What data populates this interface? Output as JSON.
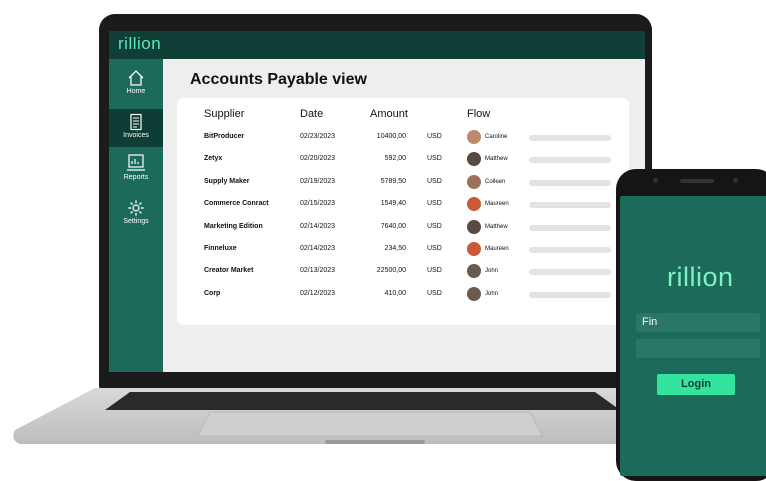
{
  "laptop": {
    "brand": "rillion",
    "nav": [
      {
        "label": "Home",
        "icon": "home-icon",
        "active": false
      },
      {
        "label": "Invoices",
        "icon": "invoice-icon",
        "active": true
      },
      {
        "label": "Reports",
        "icon": "reports-icon",
        "active": false
      },
      {
        "label": "Settings",
        "icon": "settings-gear-icon",
        "active": false
      }
    ],
    "page_title": "Accounts Payable view",
    "table": {
      "headers": {
        "supplier": "Supplier",
        "date": "Date",
        "amount": "Amount",
        "flow": "Flow"
      },
      "rows": [
        {
          "supplier": "BitProducer",
          "date": "02/23/2023",
          "amount": "10400,00",
          "currency": "USD",
          "assignee": "Caroline",
          "avatar_color": "#b98a6b"
        },
        {
          "supplier": "Zetyx",
          "date": "02/20/2023",
          "amount": "592,00",
          "currency": "USD",
          "assignee": "Matthew",
          "avatar_color": "#5a4a44"
        },
        {
          "supplier": "Supply Maker",
          "date": "02/19/2023",
          "amount": "5789,50",
          "currency": "USD",
          "assignee": "Colleen",
          "avatar_color": "#9b7358"
        },
        {
          "supplier": "Commerce Conract",
          "date": "02/15/2023",
          "amount": "1549,40",
          "currency": "USD",
          "assignee": "Maureen",
          "avatar_color": "#c85a3a"
        },
        {
          "supplier": "Marketing Edition",
          "date": "02/14/2023",
          "amount": "7640,00",
          "currency": "USD",
          "assignee": "Matthew",
          "avatar_color": "#5a4a44"
        },
        {
          "supplier": "Finneluxe",
          "date": "02/14/2023",
          "amount": "234,50",
          "currency": "USD",
          "assignee": "Maureen",
          "avatar_color": "#c85a3a"
        },
        {
          "supplier": "Creator Market",
          "date": "02/13/2023",
          "amount": "22500,00",
          "currency": "USD",
          "assignee": "John",
          "avatar_color": "#6b5a4e"
        },
        {
          "supplier": "Corp",
          "date": "02/12/2023",
          "amount": "410,00",
          "currency": "USD",
          "assignee": "John",
          "avatar_color": "#6b5a4e"
        }
      ]
    }
  },
  "phone": {
    "brand": "rillion",
    "username_value": "Fin",
    "password_value": "",
    "login_label": "Login"
  },
  "colors": {
    "topbar": "#103f37",
    "sidebar": "#1c6a5a",
    "brand_text": "#5ee8b8",
    "login_button": "#34e39e"
  }
}
